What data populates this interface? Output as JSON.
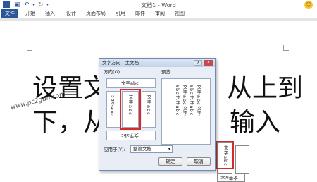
{
  "window": {
    "title": "文档1 - Word"
  },
  "ribbon": {
    "file_tab": "文件",
    "tabs": [
      "开始",
      "插入",
      "设计",
      "页面布局",
      "引用",
      "邮件",
      "审阅",
      "视图"
    ]
  },
  "document": {
    "line1": "设置文",
    "line1_right": "从上到",
    "line2": "下，从",
    "line2_right": "输入",
    "watermark": "www.pc2gun.com"
  },
  "dialog": {
    "title": "文字方向 - 主文档",
    "help": "?",
    "close": "×",
    "direction_label": "方向(O)",
    "preview_label": "预览",
    "options": [
      "文字abc",
      "文字abc",
      "文字abc",
      "文字abc",
      "文字abc"
    ],
    "preview_columns": [
      "文字abc文字",
      "abc文字abc",
      "文字abc文字",
      "abc文字abc"
    ],
    "apply_label": "应用于(Y):",
    "apply_value": "整篇文档",
    "ok": "确定",
    "cancel": "取消"
  },
  "fragments": {
    "v1": "文字abc",
    "h1": "文字abc"
  },
  "colors": {
    "accent": "#2b579a",
    "highlight": "#d62a2a"
  }
}
